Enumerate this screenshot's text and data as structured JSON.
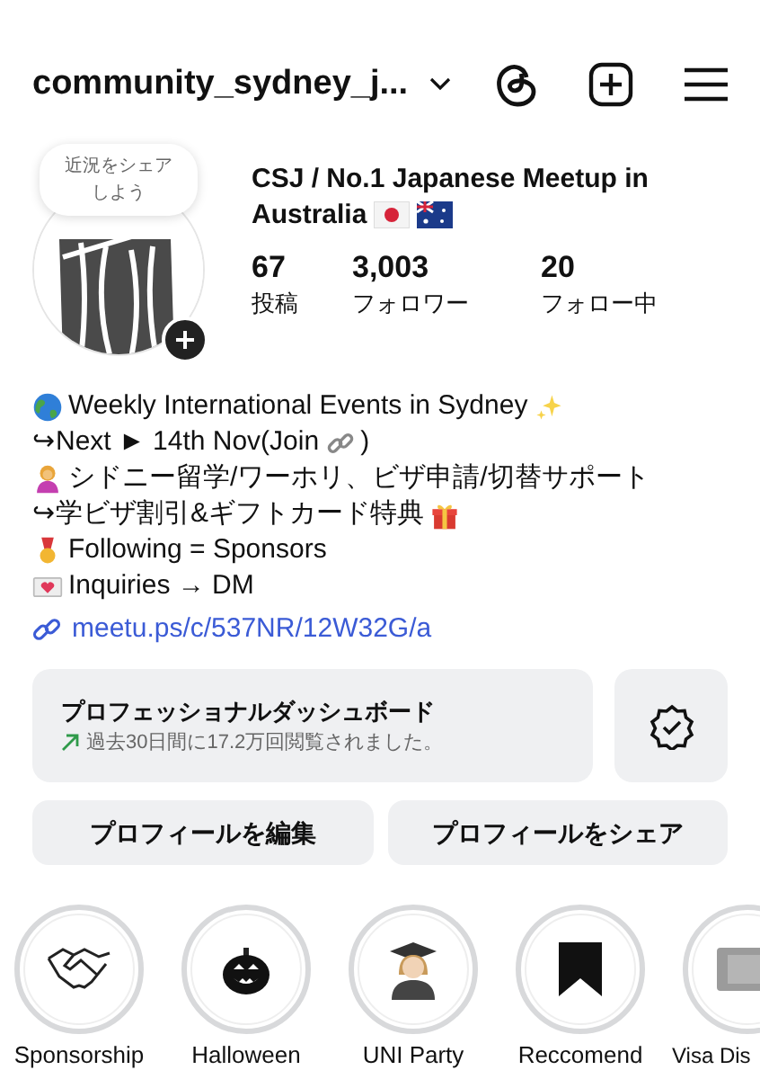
{
  "header": {
    "username": "community_sydney_j..."
  },
  "profile": {
    "note": "近況をシェアしよう",
    "name": "CSJ / No.1 Japanese Meetup in Australia",
    "name_flags": [
      {
        "kind": "japan"
      },
      {
        "kind": "australia"
      }
    ],
    "stats": [
      {
        "value": "67",
        "label": "投稿"
      },
      {
        "value": "3,003",
        "label": "フォロワー"
      },
      {
        "value": "20",
        "label": "フォロー中"
      }
    ]
  },
  "bio": [
    {
      "lead": {
        "kind": "globe"
      },
      "text": "Weekly International Events in Sydney",
      "trail": {
        "kind": "sparkles"
      }
    },
    {
      "text": "↪Next ► 14th Nov(Join",
      "trail": {
        "kind": "link"
      },
      "after": ")"
    },
    {
      "lead": {
        "kind": "person"
      },
      "text": "シドニー留学/ワーホリ、ビザ申請/切替サポート"
    },
    {
      "text": "↪学ビザ割引&ギフトカード特典",
      "trail": {
        "kind": "gift"
      }
    },
    {
      "lead": {
        "kind": "medal"
      },
      "text": "Following = Sponsors"
    },
    {
      "lead": {
        "kind": "heart"
      },
      "text": "Inquiries → DM"
    }
  ],
  "link": "meetu.ps/c/537NR/12W32G/a",
  "dashboard": {
    "title": "プロフェッショナルダッシュボード",
    "subtitle": "過去30日間に17.2万回閲覧されました。"
  },
  "buttons": [
    "プロフィールを編集",
    "プロフィールをシェア"
  ],
  "highlights": [
    {
      "kind": "handshake",
      "label": "Sponsorship"
    },
    {
      "kind": "pumpkin",
      "label": "Halloween"
    },
    {
      "kind": "graduate",
      "label": "UNI Party"
    },
    {
      "kind": "bookmark",
      "label": "Reccomend"
    },
    {
      "kind": "ticket",
      "label": "Visa Dis"
    }
  ]
}
